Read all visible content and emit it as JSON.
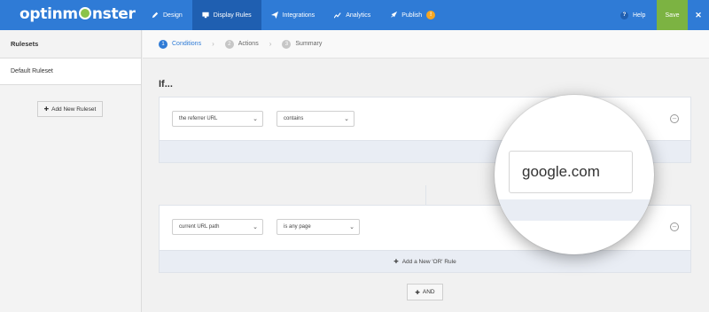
{
  "header": {
    "logo": "optinmonster",
    "nav": [
      {
        "label": "Design",
        "icon": "pencil-icon"
      },
      {
        "label": "Display Rules",
        "icon": "monitor-icon",
        "active": true
      },
      {
        "label": "Integrations",
        "icon": "paper-plane-icon"
      },
      {
        "label": "Analytics",
        "icon": "chart-icon"
      },
      {
        "label": "Publish",
        "icon": "rocket-icon"
      }
    ],
    "help_label": "Help",
    "save_label": "Save"
  },
  "sidebar": {
    "heading": "Rulesets",
    "items": [
      {
        "label": "Default Ruleset"
      }
    ],
    "add_label": "Add New Ruleset"
  },
  "steps": [
    {
      "num": "1",
      "label": "Conditions",
      "active": true
    },
    {
      "num": "2",
      "label": "Actions"
    },
    {
      "num": "3",
      "label": "Summary"
    }
  ],
  "main": {
    "title": "If...",
    "groups": [
      {
        "field": "the referrer URL",
        "operator": "contains",
        "value": "google.com"
      },
      {
        "field": "current URL path",
        "operator": "is any page",
        "add_or_label": "Add a New 'OR' Rule"
      }
    ],
    "and_label": "AND"
  },
  "colors": {
    "primary": "#2f7bd6",
    "active_nav": "#1f5fb1",
    "save": "#7cb342",
    "badge": "#f5a623"
  }
}
